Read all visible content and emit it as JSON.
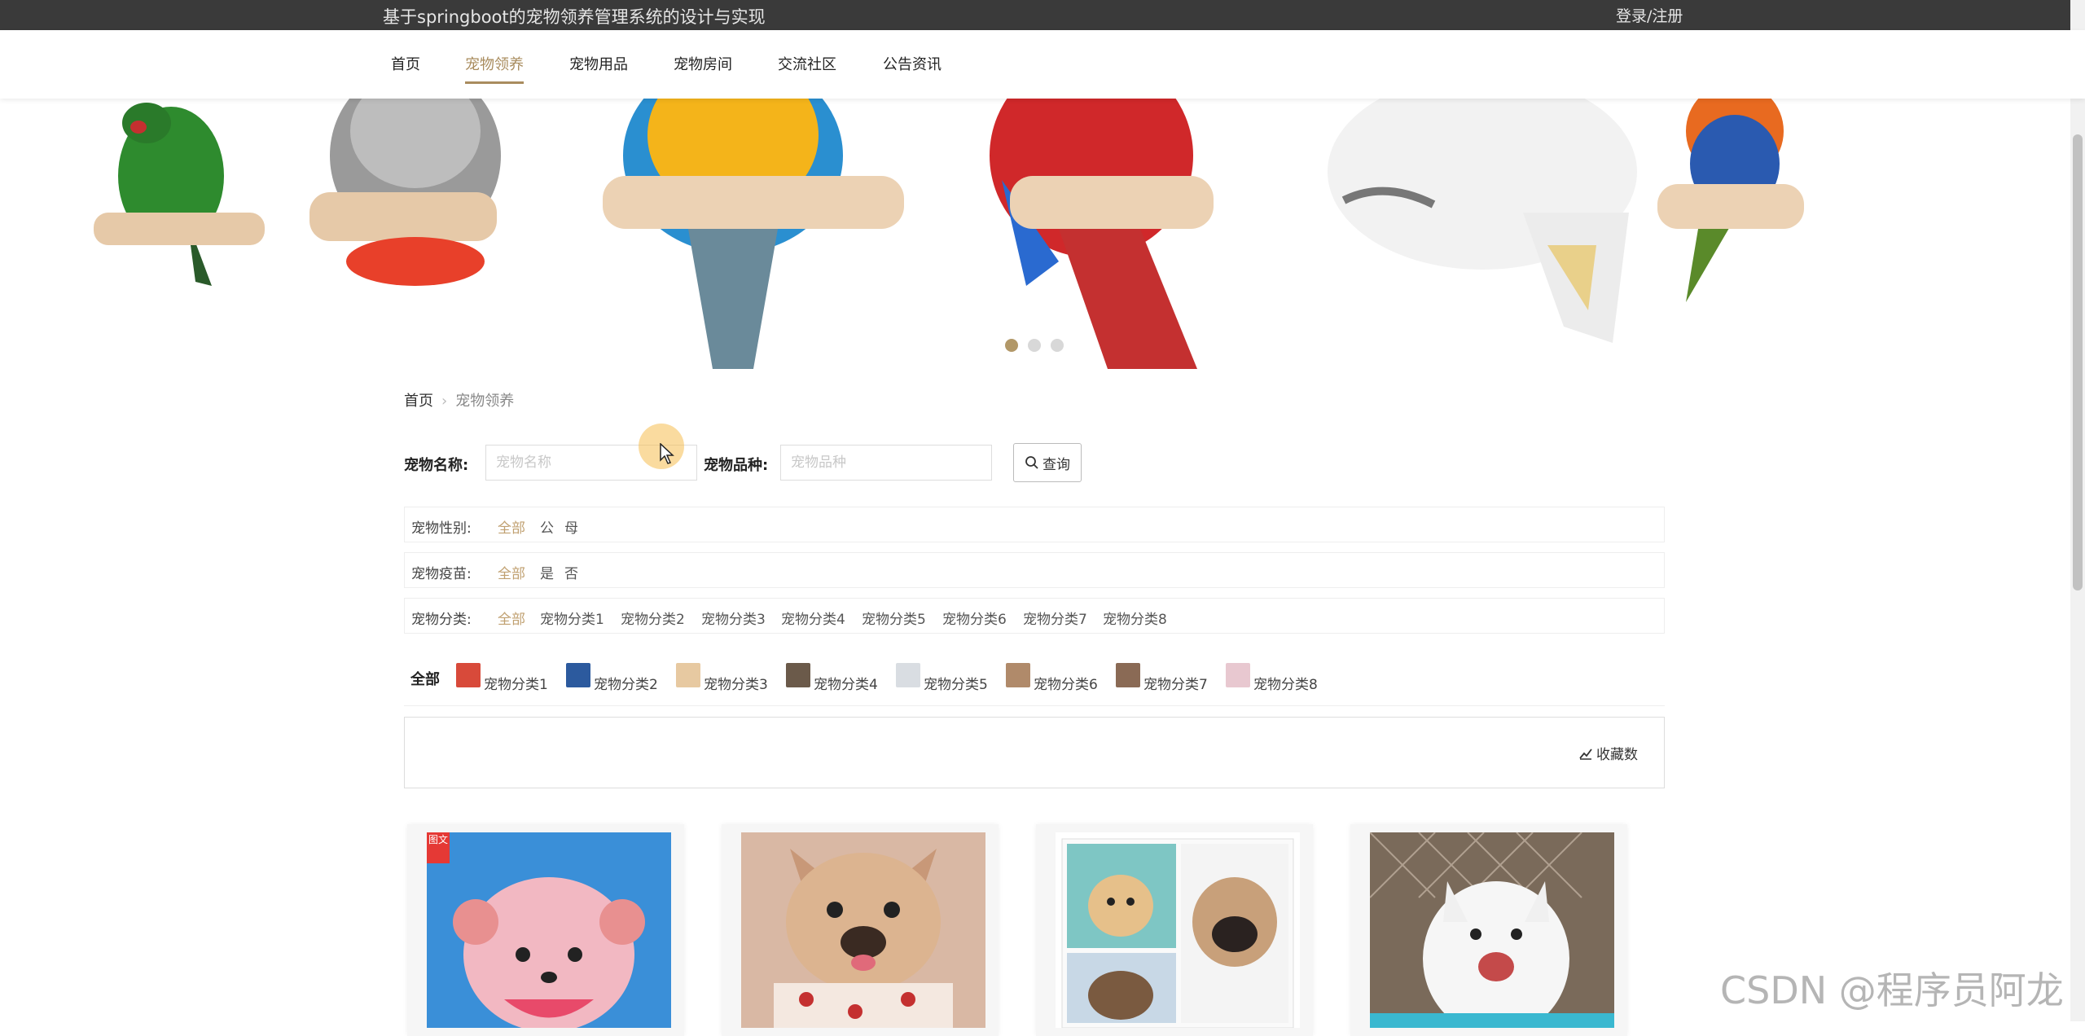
{
  "header": {
    "site_title": "基于springboot的宠物领养管理系统的设计与实现",
    "login_register": "登录/注册"
  },
  "nav": {
    "items": [
      {
        "label": "首页"
      },
      {
        "label": "宠物领养"
      },
      {
        "label": "宠物用品"
      },
      {
        "label": "宠物房间"
      },
      {
        "label": "交流社区"
      },
      {
        "label": "公告资讯"
      }
    ],
    "active_index": 1
  },
  "banner": {
    "slide_count": 3,
    "active_slide": 0
  },
  "breadcrumb": {
    "home": "首页",
    "current": "宠物领养"
  },
  "search": {
    "name_label": "宠物名称:",
    "name_placeholder": "宠物名称",
    "breed_label": "宠物品种:",
    "breed_placeholder": "宠物品种",
    "query_button": "查询"
  },
  "filters": {
    "gender": {
      "label": "宠物性别:",
      "options": [
        "全部",
        "公",
        "母"
      ],
      "active": 0
    },
    "vaccine": {
      "label": "宠物疫苗:",
      "options": [
        "全部",
        "是",
        "否"
      ],
      "active": 0
    },
    "category": {
      "label": "宠物分类:",
      "options": [
        "全部",
        "宠物分类1",
        "宠物分类2",
        "宠物分类3",
        "宠物分类4",
        "宠物分类5",
        "宠物分类6",
        "宠物分类7",
        "宠物分类8"
      ],
      "active": 0
    }
  },
  "category_tabs": {
    "all_label": "全部",
    "tabs": [
      {
        "name": "宠物分类1",
        "color": "#d84a3a"
      },
      {
        "name": "宠物分类2",
        "color": "#2c5a9e"
      },
      {
        "name": "宠物分类3",
        "color": "#e7c9a1"
      },
      {
        "name": "宠物分类4",
        "color": "#6b5a4a"
      },
      {
        "name": "宠物分类5",
        "color": "#d9dde2"
      },
      {
        "name": "宠物分类6",
        "color": "#b08a6a"
      },
      {
        "name": "宠物分类7",
        "color": "#8a6a55"
      },
      {
        "name": "宠物分类8",
        "color": "#e8c8d0"
      }
    ]
  },
  "sort": {
    "favorites_label": "收藏数"
  },
  "cards": {
    "badge": "图文"
  },
  "watermark": "CSDN @程序员阿龙",
  "colors": {
    "accent": "#a98c5e",
    "topbar": "#3a3a3a",
    "active_filter": "#c0a070"
  }
}
